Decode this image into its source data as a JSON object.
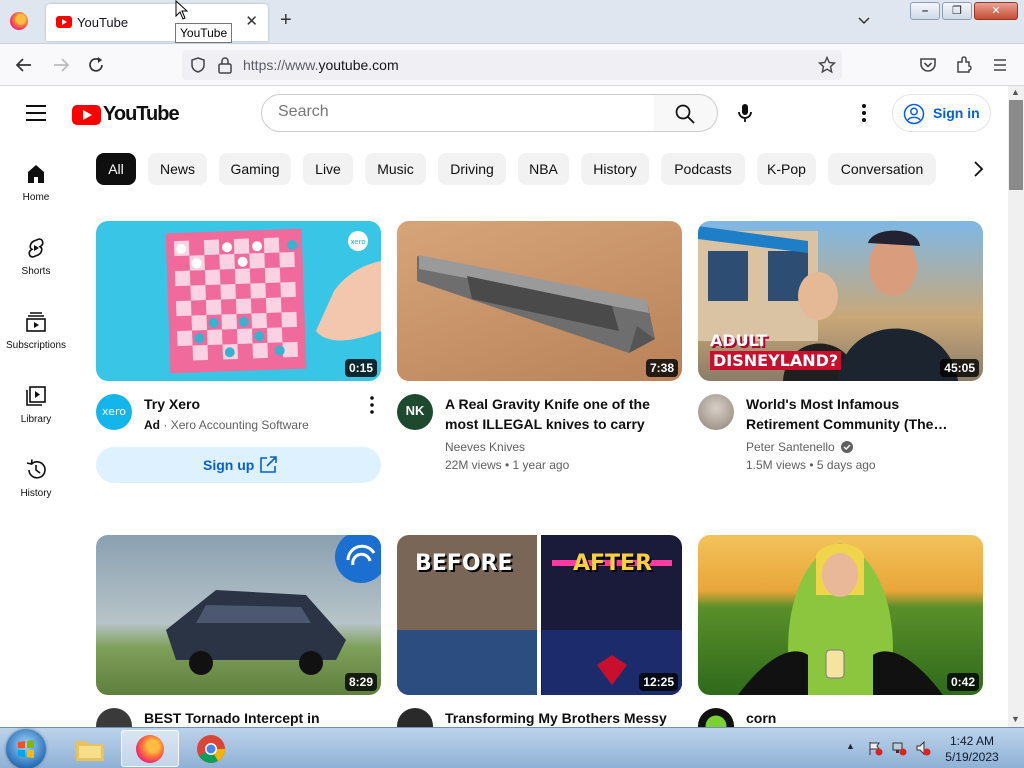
{
  "browser": {
    "tab_title": "YouTube",
    "tooltip": "YouTube",
    "url_prefix": "https://www.",
    "url_domain": "youtube.com",
    "window_buttons": [
      "–",
      "❐",
      "✕"
    ]
  },
  "header": {
    "logo_text": "YouTube",
    "search_placeholder": "Search",
    "sign_in_label": "Sign in"
  },
  "sidebar": {
    "items": [
      {
        "label": "Home",
        "icon": "home-icon"
      },
      {
        "label": "Shorts",
        "icon": "shorts-icon"
      },
      {
        "label": "Subscriptions",
        "icon": "subscriptions-icon"
      },
      {
        "label": "Library",
        "icon": "library-icon"
      },
      {
        "label": "History",
        "icon": "history-icon"
      }
    ]
  },
  "chips": [
    "All",
    "News",
    "Gaming",
    "Live",
    "Music",
    "Driving",
    "NBA",
    "History",
    "Podcasts",
    "K-Pop",
    "Conversation"
  ],
  "videos": [
    {
      "title": "Try Xero",
      "ad_badge": "Ad",
      "ad_sep": "·",
      "channel": "Xero Accounting Software",
      "duration": "0:15",
      "cta": "Sign up",
      "avatar_text": "xero"
    },
    {
      "title": "A Real Gravity Knife one of the most ILLEGAL knives to carry",
      "channel": "Neeves Knives",
      "meta": "22M views • 1 year ago",
      "duration": "7:38",
      "avatar_text": "NK"
    },
    {
      "title": "World's Most Infamous Retirement Community (The…",
      "channel": "Peter Santenello",
      "meta": "1.5M views • 5 days ago",
      "duration": "45:05",
      "thumb_text": [
        "ADULT",
        "DISNEYLAND?"
      ]
    },
    {
      "title": "BEST Tornado Intercept in History",
      "duration": "8:29"
    },
    {
      "title": "Transforming My Brothers Messy",
      "duration": "12:25",
      "thumb_text": [
        "BEFORE",
        "AFTER"
      ]
    },
    {
      "title": "corn",
      "duration": "0:42"
    }
  ],
  "taskbar": {
    "time": "1:42 AM",
    "date": "5/19/2023"
  },
  "colors": {
    "brand_red": "#ff0000",
    "link_blue": "#065fd4",
    "chip_bg": "#f2f2f2"
  }
}
